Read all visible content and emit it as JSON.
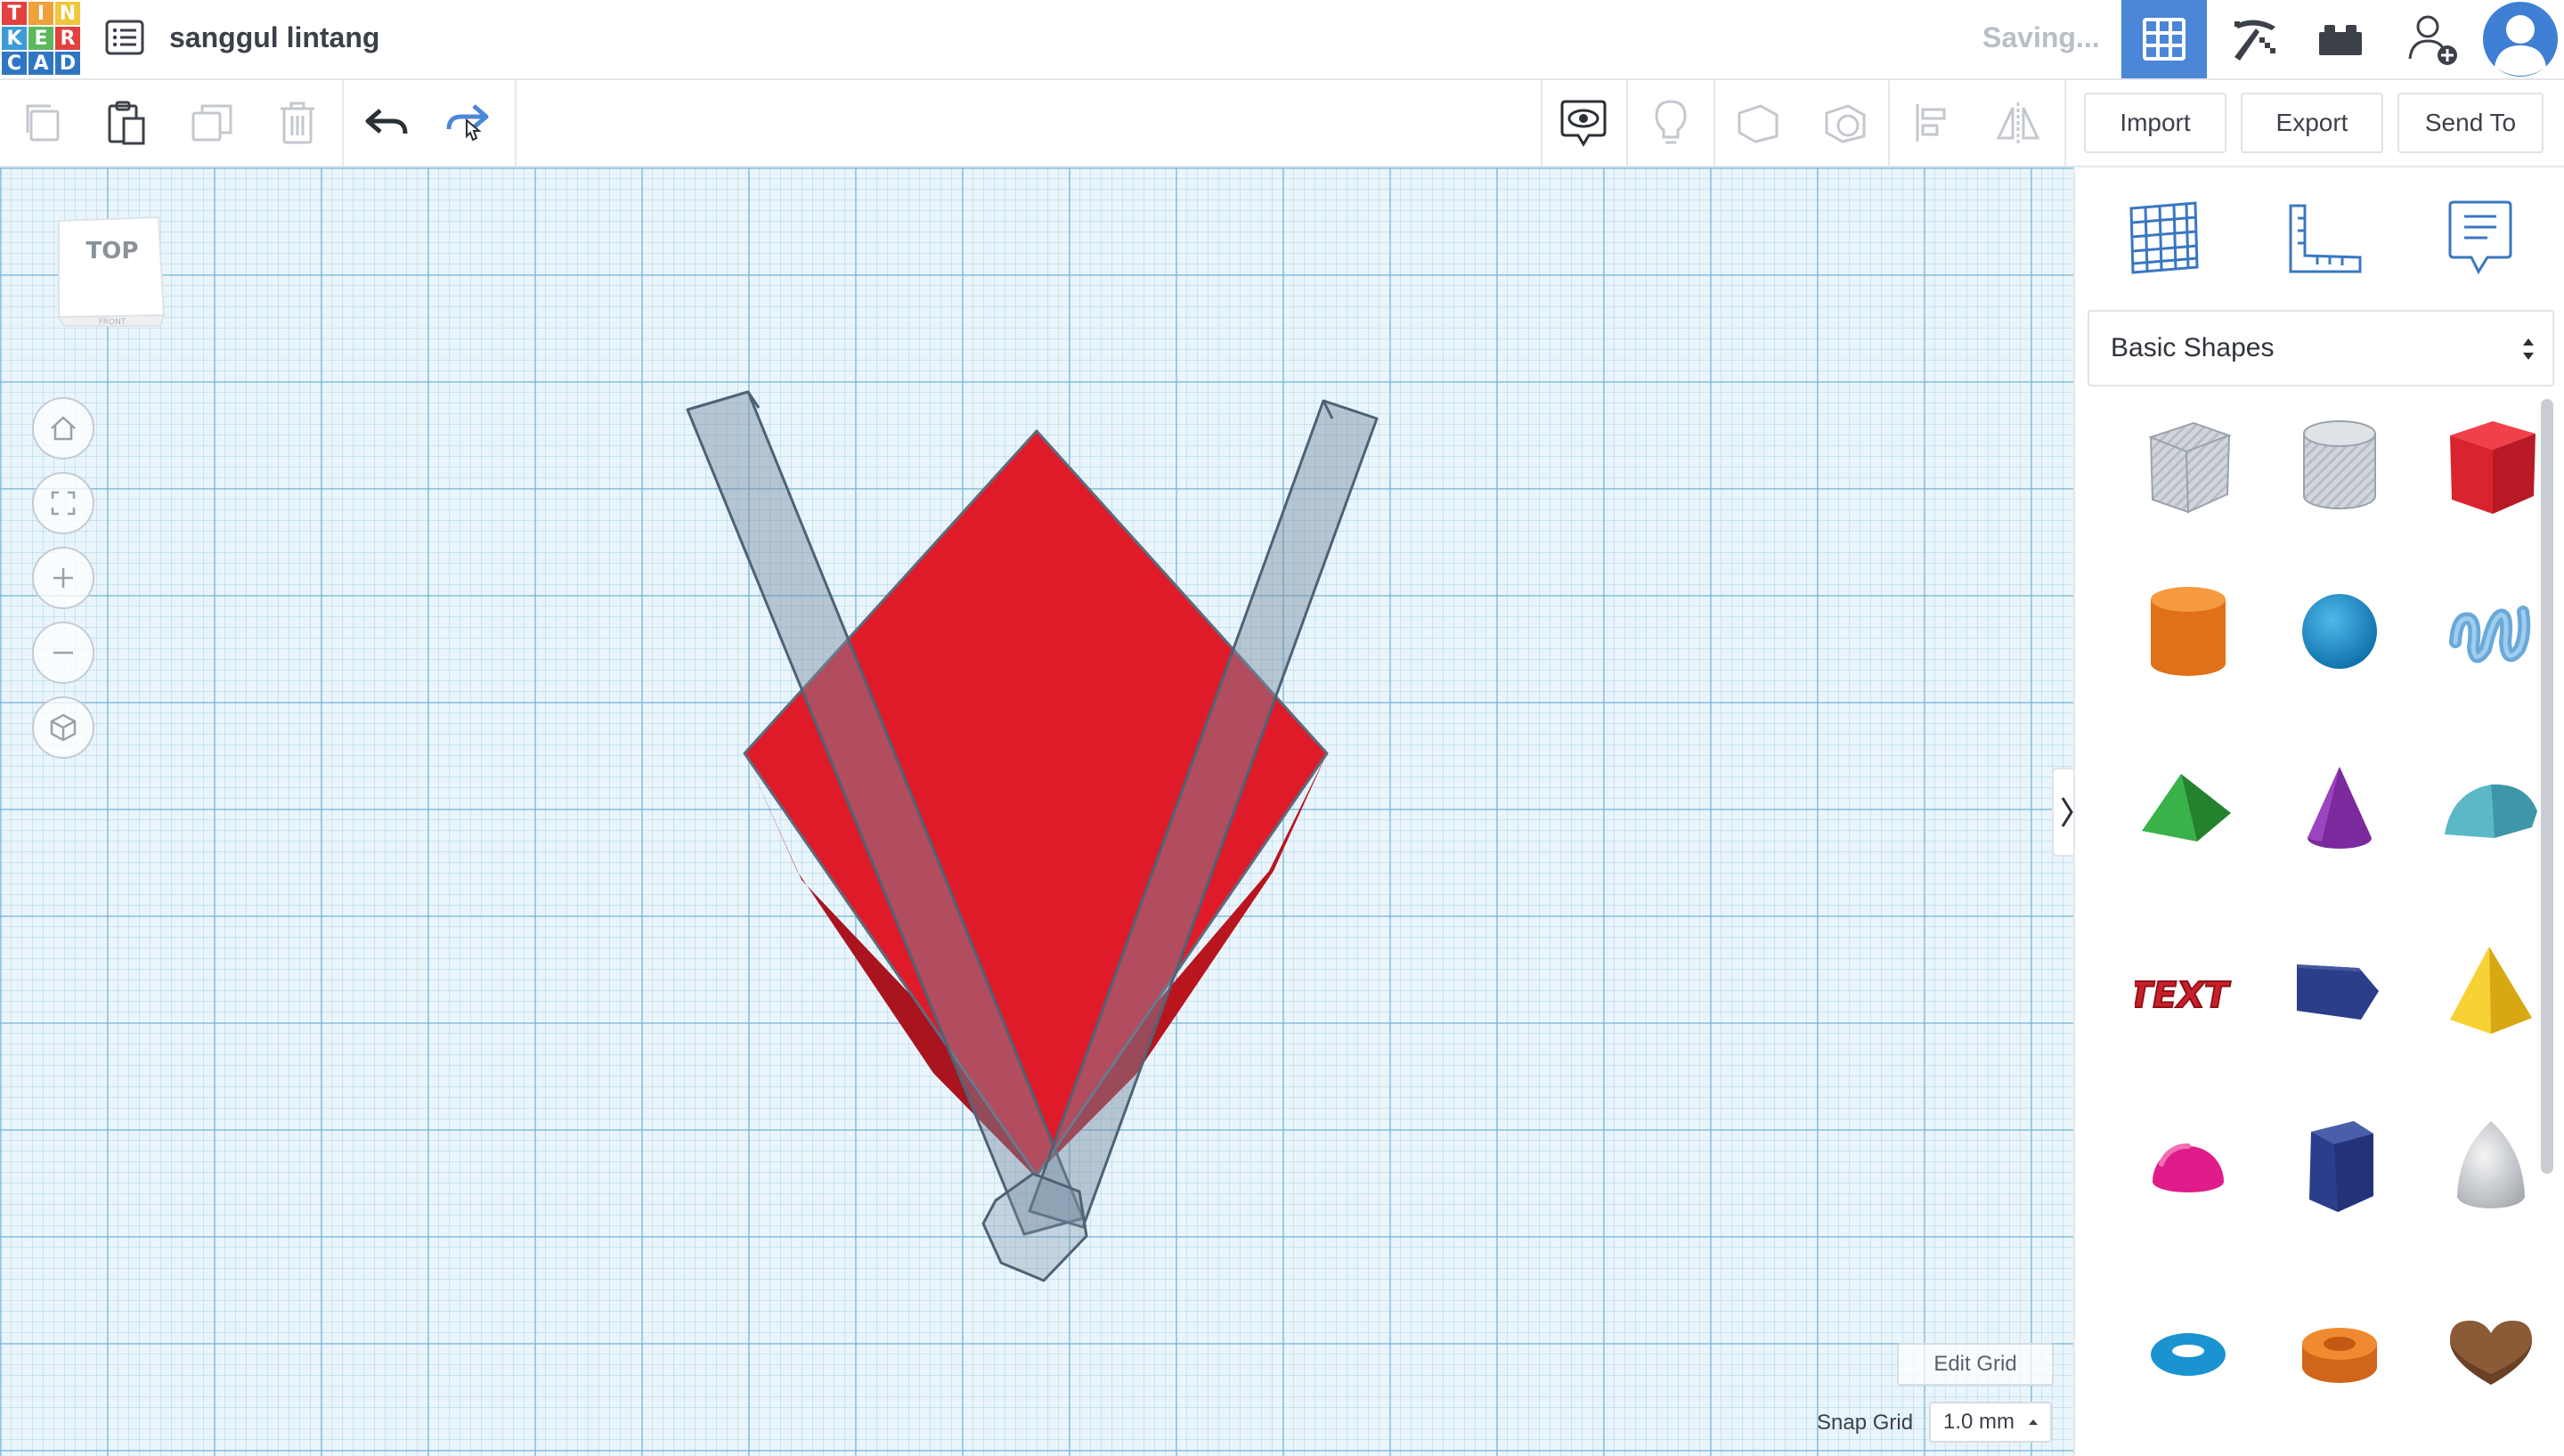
{
  "header": {
    "logo_letters": [
      "T",
      "I",
      "N",
      "K",
      "E",
      "R",
      "C",
      "A",
      "D"
    ],
    "design_title": "sanggul lintang",
    "status": "Saving...",
    "nav_icons": [
      "3d-view-grid-icon",
      "pickaxe-build-icon",
      "lego-brick-icon",
      "invite-user-icon",
      "user-avatar-icon"
    ]
  },
  "toolbar": {
    "left_icons": [
      "copy-icon",
      "paste-icon",
      "duplicate-icon",
      "delete-icon",
      "undo-icon",
      "redo-icon"
    ],
    "right_icons": [
      "notes-toggle-icon",
      "light-bulb-icon",
      "group-shapes-icon",
      "ungroup-shapes-icon",
      "align-icon",
      "mirror-icon"
    ],
    "import_label": "Import",
    "export_label": "Export",
    "send_to_label": "Send To"
  },
  "workplane": {
    "viewcube_top": "TOP",
    "viewcube_front": "FRONT",
    "nav_controls": [
      "home-view-icon",
      "fit-view-icon",
      "zoom-in-icon",
      "zoom-out-icon",
      "perspective-icon"
    ],
    "edit_grid_label": "Edit Grid",
    "snap_grid_label": "Snap Grid",
    "snap_grid_value": "1.0 mm"
  },
  "panel": {
    "tools": [
      "workplane-icon",
      "ruler-icon",
      "notes-icon"
    ],
    "category": "Basic Shapes",
    "shapes": [
      {
        "name": "box-hole",
        "color": "#c8ccd2"
      },
      {
        "name": "cylinder-hole",
        "color": "#c8ccd2"
      },
      {
        "name": "box",
        "color": "#d9232e"
      },
      {
        "name": "cylinder",
        "color": "#ef7d1a"
      },
      {
        "name": "sphere",
        "color": "#1a8fd0"
      },
      {
        "name": "scribble",
        "color": "#6aa9d9"
      },
      {
        "name": "roof",
        "color": "#2e9e3e"
      },
      {
        "name": "cone",
        "color": "#7a2a9c"
      },
      {
        "name": "round-roof",
        "color": "#5ab8c7"
      },
      {
        "name": "text",
        "color": "#c8202a"
      },
      {
        "name": "wedge",
        "color": "#2c3e8a"
      },
      {
        "name": "pyramid",
        "color": "#f2c51d"
      },
      {
        "name": "half-sphere",
        "color": "#e01b8a"
      },
      {
        "name": "polygon",
        "color": "#2b3e8c"
      },
      {
        "name": "paraboloid",
        "color": "#c7c9cc"
      },
      {
        "name": "torus",
        "color": "#1a94d0"
      },
      {
        "name": "tube",
        "color": "#ea7a1c"
      },
      {
        "name": "heart",
        "color": "#8b5a36"
      }
    ]
  },
  "colors": {
    "accent": "#4b87d6",
    "red_shape": "#dd1c2b",
    "hole": "#b8c4cf"
  }
}
